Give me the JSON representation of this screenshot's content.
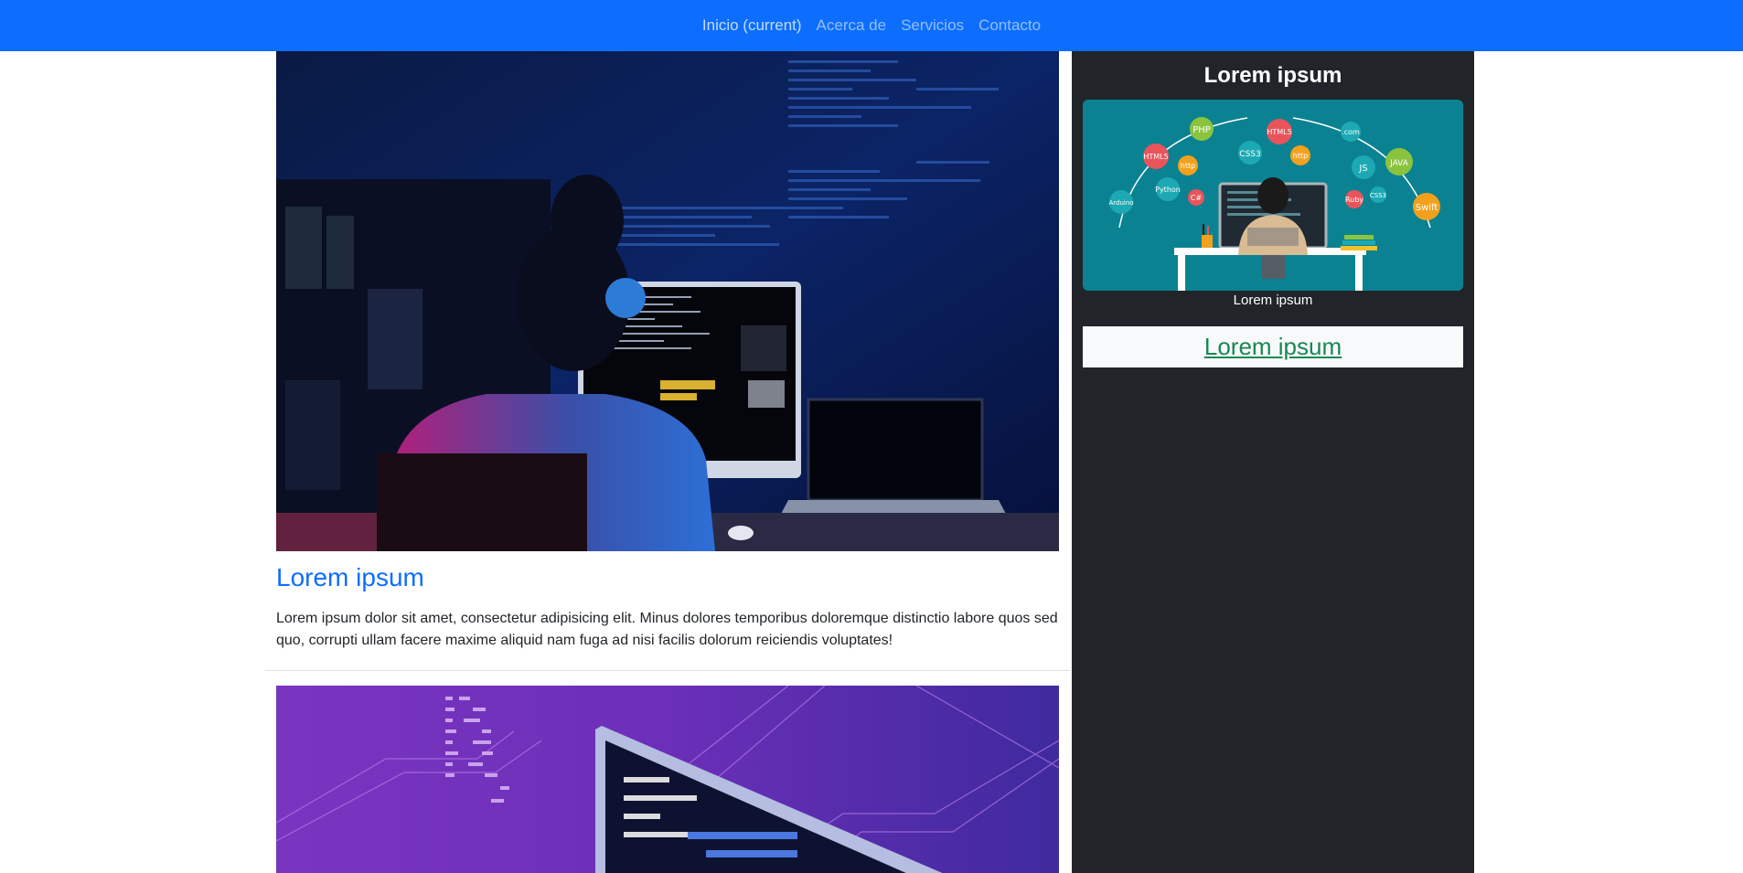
{
  "nav": {
    "items": [
      {
        "label": "Inicio (current)"
      },
      {
        "label": "Acerca de"
      },
      {
        "label": "Servicios"
      },
      {
        "label": "Contacto"
      }
    ]
  },
  "post": {
    "title": "Lorem ipsum",
    "text": "Lorem ipsum dolor sit amet, consectetur adipisicing elit. Minus dolores temporibus doloremque distinctio labore quos sed quo, corrupti ullam facere maxime aliquid nam fuga ad nisi facilis dolorum reiciendis voluptates!"
  },
  "sidebar": {
    "title": "Lorem ipsum",
    "caption": "Lorem ipsum",
    "link": "Lorem ipsum",
    "image_tags": [
      "PHP",
      "HTML5",
      "HTML5",
      "CSS3",
      "http",
      "http",
      "JS",
      "JAVA",
      "Python",
      "C#",
      "Ruby",
      "CSS3",
      "Swift",
      "Arduino",
      ".com"
    ]
  },
  "colors": {
    "navbar": "#0d6efd",
    "sidebar": "#212529",
    "title": "#0d6efd",
    "sidebar_link": "#198754"
  }
}
